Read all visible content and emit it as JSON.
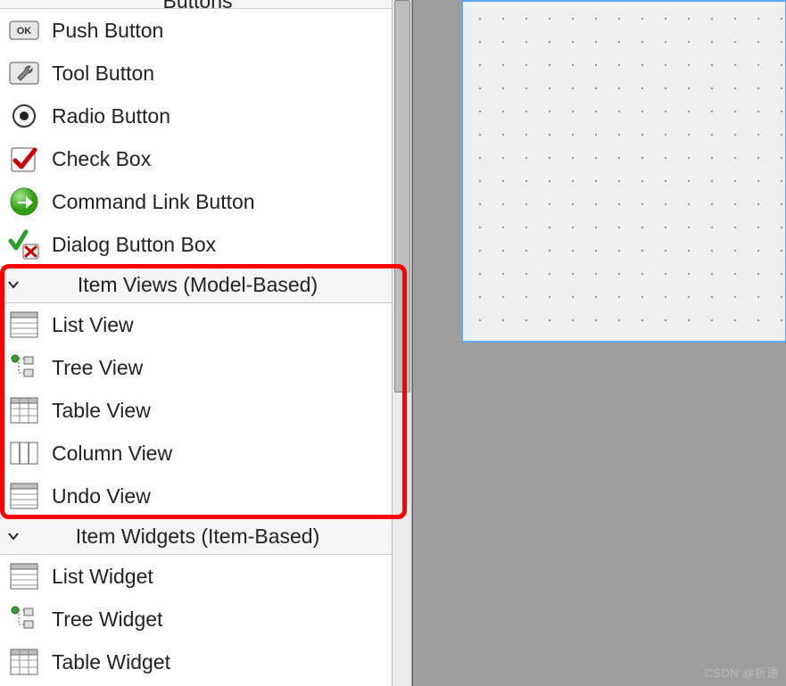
{
  "categories": [
    {
      "id": "buttons",
      "header": "Buttons",
      "partial_top": true,
      "expanded": true,
      "items": [
        {
          "id": "push-button",
          "label": "Push Button",
          "icon": "ok-button-icon"
        },
        {
          "id": "tool-button",
          "label": "Tool Button",
          "icon": "wrench-icon"
        },
        {
          "id": "radio-button",
          "label": "Radio Button",
          "icon": "radio-icon"
        },
        {
          "id": "check-box",
          "label": "Check Box",
          "icon": "checkbox-icon"
        },
        {
          "id": "command-link-button",
          "label": "Command Link Button",
          "icon": "arrow-circle-icon"
        },
        {
          "id": "dialog-button-box",
          "label": "Dialog Button Box",
          "icon": "check-x-icon"
        }
      ]
    },
    {
      "id": "item-views",
      "header": "Item Views (Model-Based)",
      "expanded": true,
      "highlighted": true,
      "items": [
        {
          "id": "list-view",
          "label": "List View",
          "icon": "list-table-icon"
        },
        {
          "id": "tree-view",
          "label": "Tree View",
          "icon": "tree-icon"
        },
        {
          "id": "table-view",
          "label": "Table View",
          "icon": "table-icon"
        },
        {
          "id": "column-view",
          "label": "Column View",
          "icon": "columns-icon"
        },
        {
          "id": "undo-view",
          "label": "Undo View",
          "icon": "list-table-icon"
        }
      ]
    },
    {
      "id": "item-widgets",
      "header": "Item Widgets (Item-Based)",
      "expanded": true,
      "items": [
        {
          "id": "list-widget",
          "label": "List Widget",
          "icon": "list-table-icon"
        },
        {
          "id": "tree-widget",
          "label": "Tree Widget",
          "icon": "tree-icon"
        },
        {
          "id": "table-widget",
          "label": "Table Widget",
          "icon": "table-icon"
        }
      ]
    }
  ],
  "watermark": "CSDN @折途"
}
